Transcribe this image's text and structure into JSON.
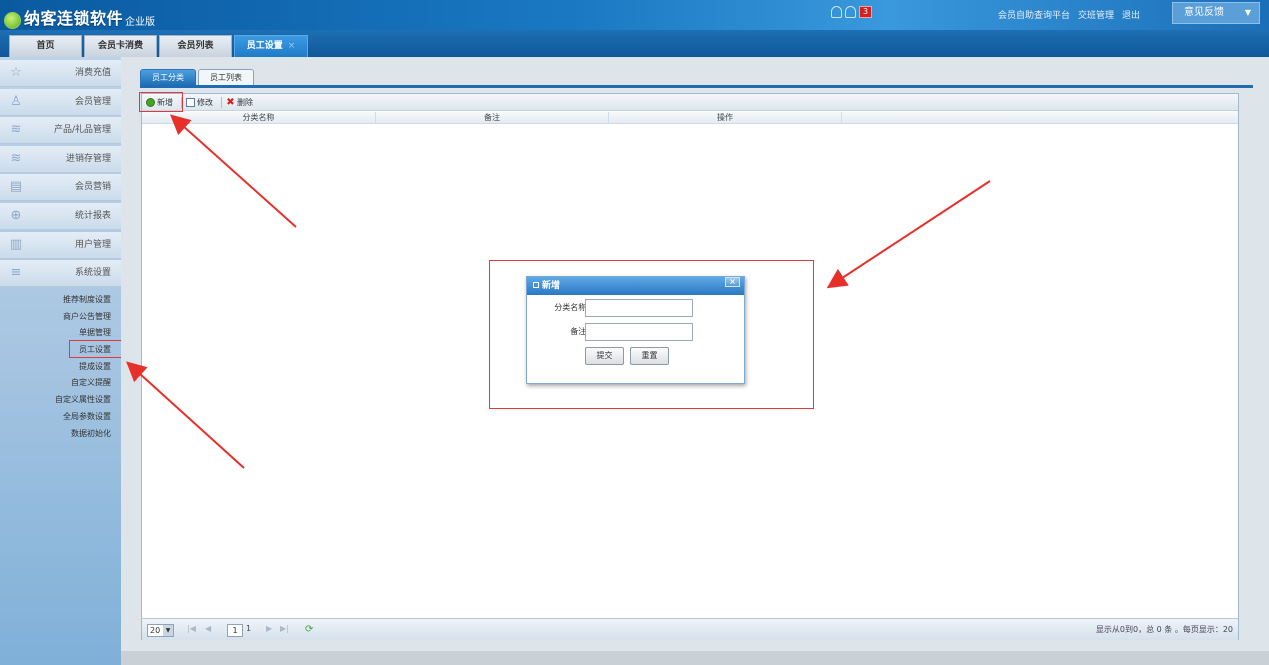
{
  "header": {
    "logo_text": "纳客连锁软件",
    "edition": "企业版",
    "notification_count": "3",
    "links": [
      "会员自助查询平台",
      "交班管理",
      "退出"
    ],
    "feedback_label": "意见反馈"
  },
  "top_tabs": [
    {
      "label": "首页"
    },
    {
      "label": "会员卡消费"
    },
    {
      "label": "会员列表"
    },
    {
      "label": "员工设置",
      "close": "×"
    }
  ],
  "sidebar": {
    "items": [
      {
        "label": "消费充值",
        "icon": "☆"
      },
      {
        "label": "会员管理",
        "icon": "♙"
      },
      {
        "label": "产品/礼品管理",
        "icon": "≋"
      },
      {
        "label": "进销存管理",
        "icon": "≋"
      },
      {
        "label": "会员营销",
        "icon": "▤"
      },
      {
        "label": "统计报表",
        "icon": "⊕"
      },
      {
        "label": "用户管理",
        "icon": "▥"
      },
      {
        "label": "系统设置",
        "icon": "≡"
      }
    ],
    "sub_items": [
      "推荐制度设置",
      "商户公告管理",
      "单据管理",
      "员工设置",
      "提成设置",
      "自定义提醒",
      "自定义属性设置",
      "全局参数设置",
      "数据初始化"
    ]
  },
  "subtabs": [
    "员工分类",
    "员工列表"
  ],
  "toolbar": {
    "add": "新增",
    "edit": "修改",
    "delete": "删除"
  },
  "columns": [
    "分类名称",
    "备注",
    "操作"
  ],
  "pager": {
    "page_size": "20",
    "page": "1",
    "total_pages": "1",
    "info": "显示从0到0，总 0 条 。每页显示：20"
  },
  "dialog": {
    "title": "新增",
    "close": "×",
    "fields": [
      {
        "label": "分类名称:",
        "value": ""
      },
      {
        "label": "备注:",
        "value": ""
      }
    ],
    "submit": "提交",
    "reset": "重置"
  }
}
